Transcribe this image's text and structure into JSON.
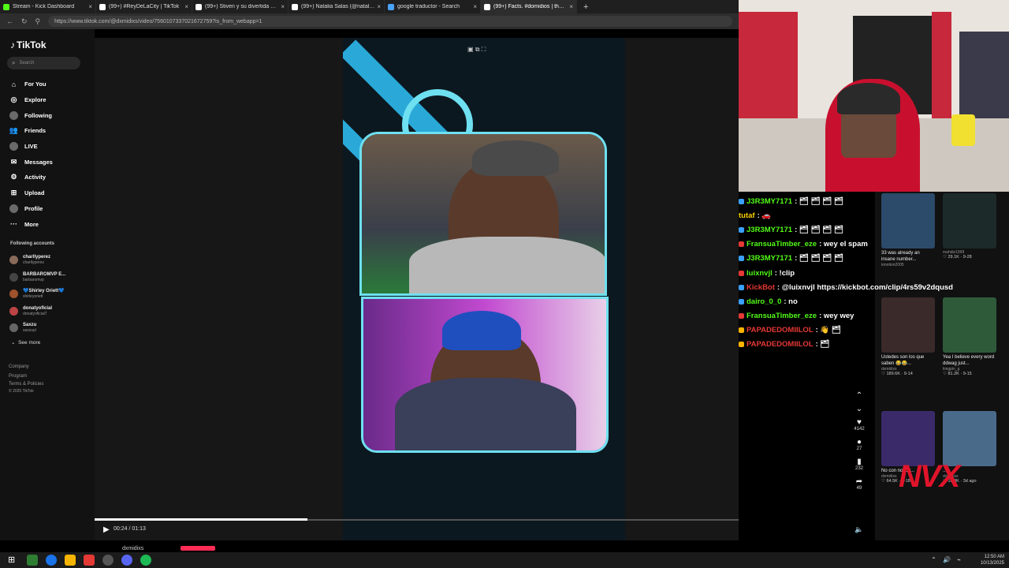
{
  "browser": {
    "tabs": [
      {
        "title": "Stream - Kick Dashboard",
        "color": "#53fc18",
        "active": false
      },
      {
        "title": "(99+) #ReyDeLaCity | TikTok",
        "color": "#ffffff",
        "active": false
      },
      {
        "title": "(99+) Stiven y su divertida carrera",
        "color": "#ffffff",
        "active": false
      },
      {
        "title": "(99+) Natalia Salas (@nataliasalas...",
        "color": "#ffffff",
        "active": false
      },
      {
        "title": "google traductor - Search",
        "color": "#4aa3ff",
        "active": false
      },
      {
        "title": "(99+) Facts. #domidios | the d'am...",
        "color": "#ffffff",
        "active": true
      }
    ],
    "new_tab": "+",
    "url": "https://www.tiktok.com/@dxmidixs/video/7560107337021672759?is_from_webapp=1"
  },
  "sidebar": {
    "logo": "TikTok",
    "search_placeholder": "Search",
    "nav": [
      {
        "label": "For You",
        "icon": "home-icon",
        "glyph": "⌂"
      },
      {
        "label": "Explore",
        "icon": "compass-icon",
        "glyph": "◎"
      },
      {
        "label": "Following",
        "icon": "following-avatar-icon",
        "glyph": ""
      },
      {
        "label": "Friends",
        "icon": "friends-icon",
        "glyph": "👥"
      },
      {
        "label": "LIVE",
        "icon": "live-avatar-icon",
        "glyph": ""
      },
      {
        "label": "Messages",
        "icon": "messages-icon",
        "glyph": "✉"
      },
      {
        "label": "Activity",
        "icon": "activity-icon",
        "glyph": "⚙"
      },
      {
        "label": "Upload",
        "icon": "upload-icon",
        "glyph": "⊞"
      },
      {
        "label": "Profile",
        "icon": "profile-avatar-icon",
        "glyph": ""
      },
      {
        "label": "More",
        "icon": "more-icon",
        "glyph": "···"
      }
    ],
    "following_title": "Following accounts",
    "accounts": [
      {
        "name": "charllyperez",
        "handle": "charllyperez",
        "color": "#8a6a5a"
      },
      {
        "name": "BARBAROMVP E...",
        "handle": "barbaromvp",
        "color": "#444"
      },
      {
        "name": "💙Shirley Oriett💙",
        "handle": "shirleyoriett",
        "color": "#a0522d"
      },
      {
        "name": "donatyoficial",
        "handle": "donatyoficial7",
        "color": "#b44"
      },
      {
        "name": "Saxzu",
        "handle": "saxzuyt",
        "color": "#666"
      }
    ],
    "see_more": "See more",
    "footer": [
      "Company",
      "Program",
      "Terms & Policies"
    ],
    "copyright": "© 2025 TikTok"
  },
  "player": {
    "time": "00:24 / 01:13",
    "progress": 0.33,
    "creator": "dxmidixs"
  },
  "actions": [
    {
      "icon": "chevron-up-icon",
      "glyph": "⌃",
      "count": ""
    },
    {
      "icon": "chevron-down-icon",
      "glyph": "⌄",
      "count": ""
    },
    {
      "icon": "heart-icon",
      "glyph": "♥",
      "count": "4142"
    },
    {
      "icon": "comment-icon",
      "glyph": "●",
      "count": "27"
    },
    {
      "icon": "bookmark-icon",
      "glyph": "▮",
      "count": "232"
    },
    {
      "icon": "share-icon",
      "glyph": "➦",
      "count": "49"
    }
  ],
  "chat": [
    {
      "user": "J3R3MY7171",
      "color": "#53fc18",
      "badge": "#3aa0ff",
      "text": ": 🗂 🗂 🗂 🗂"
    },
    {
      "user": "tutaf",
      "color": "#ffd000",
      "badge": "",
      "text": ": 🚗"
    },
    {
      "user": "J3R3MY7171",
      "color": "#53fc18",
      "badge": "#3aa0ff",
      "text": ": 🗂 🗂 🗂 🗂"
    },
    {
      "user": "FransuaTimber_eze",
      "color": "#53fc18",
      "badge": "#e53935",
      "text": ": wey el spam"
    },
    {
      "user": "J3R3MY7171",
      "color": "#53fc18",
      "badge": "#3aa0ff",
      "text": ": 🗂 🗂 🗂 🗂"
    },
    {
      "user": "luixnvjl",
      "color": "#53fc18",
      "badge": "#e53935",
      "text": ": !clip"
    },
    {
      "user": "KickBot",
      "color": "#e53935",
      "badge": "#3aa0ff",
      "text": ": @luixnvjl https://kickbot.com/clip/4rs59v2dqusd"
    },
    {
      "user": "dairo_0_0",
      "color": "#53fc18",
      "badge": "#3aa0ff",
      "text": ": no"
    },
    {
      "user": "FransuaTimber_eze",
      "color": "#53fc18",
      "badge": "#e53935",
      "text": ": wey wey"
    },
    {
      "user": "PAPADEDOMIILOL",
      "color": "#e53935",
      "badge": "#ffb300",
      "text": ": 👋 🗂"
    },
    {
      "user": "PAPADEDOMIILOL",
      "color": "#e53935",
      "badge": "#ffb300",
      "text": ": 🗂"
    }
  ],
  "recommended": [
    {
      "caption": "33 was already an insane number...",
      "author": "kmotion2005",
      "stats": "",
      "color": "#2c4a6a"
    },
    {
      "caption": "",
      "author": "mahdiz1999",
      "stats": "♡ 29.1K · 9-28",
      "color": "#1c2a2a"
    },
    {
      "caption": "Ustedes son los que saben 😂😂...",
      "author": "dxmidixs",
      "stats": "♡ 189.6K · 9-14",
      "color": "#3a2a2a"
    },
    {
      "caption": "Yea I believe every word ddwag just...",
      "author": "kingpin_g",
      "stats": "♡ 81.2K · 9-15",
      "color": "#2f5a3a"
    },
    {
      "caption": "No con nosotr...",
      "author": "dxmidixs",
      "stats": "♡ 64.5K · 9-18",
      "color": "#3a2a6a"
    },
    {
      "caption": "...",
      "author": "dxmidixs",
      "stats": "♡ 16.8K · 3d ago",
      "color": "#4a6a8a"
    }
  ],
  "watermark": "NVX",
  "tray": {
    "time": "12:50 AM",
    "date": "10/13/2025"
  }
}
